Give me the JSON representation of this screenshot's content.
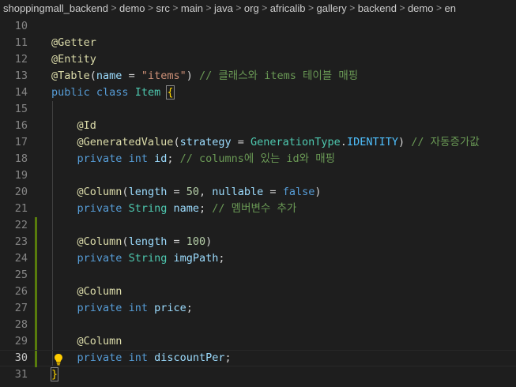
{
  "breadcrumb": {
    "items": [
      "shoppingmall_backend",
      "demo",
      "src",
      "main",
      "java",
      "org",
      "africalib",
      "gallery",
      "backend",
      "demo",
      "en"
    ],
    "separator": ">"
  },
  "editor": {
    "active_line": "30",
    "lines": [
      {
        "num": "10",
        "tokens": []
      },
      {
        "num": "11",
        "tokens": [
          {
            "t": "@Getter",
            "c": "annot"
          }
        ]
      },
      {
        "num": "12",
        "tokens": [
          {
            "t": "@Entity",
            "c": "annot"
          }
        ]
      },
      {
        "num": "13",
        "tokens": [
          {
            "t": "@Table",
            "c": "annot"
          },
          {
            "t": "(",
            "c": "plain"
          },
          {
            "t": "name",
            "c": "var"
          },
          {
            "t": " = ",
            "c": "plain"
          },
          {
            "t": "\"items\"",
            "c": "str"
          },
          {
            "t": ") ",
            "c": "plain"
          },
          {
            "t": "// 클래스와 items 테이블 매핑",
            "c": "comment"
          }
        ]
      },
      {
        "num": "14",
        "tokens": [
          {
            "t": "public",
            "c": "kw"
          },
          {
            "t": " ",
            "c": "plain"
          },
          {
            "t": "class",
            "c": "kw"
          },
          {
            "t": " ",
            "c": "plain"
          },
          {
            "t": "Item",
            "c": "type"
          },
          {
            "t": " ",
            "c": "plain"
          },
          {
            "t": "{",
            "c": "brace"
          }
        ]
      },
      {
        "num": "15",
        "tokens": []
      },
      {
        "num": "16",
        "tokens": [
          {
            "t": "    ",
            "c": "plain"
          },
          {
            "t": "@Id",
            "c": "annot"
          }
        ]
      },
      {
        "num": "17",
        "tokens": [
          {
            "t": "    ",
            "c": "plain"
          },
          {
            "t": "@GeneratedValue",
            "c": "annot"
          },
          {
            "t": "(",
            "c": "plain"
          },
          {
            "t": "strategy",
            "c": "var"
          },
          {
            "t": " = ",
            "c": "plain"
          },
          {
            "t": "GenerationType",
            "c": "type"
          },
          {
            "t": ".",
            "c": "plain"
          },
          {
            "t": "IDENTITY",
            "c": "const"
          },
          {
            "t": ") ",
            "c": "plain"
          },
          {
            "t": "// 자동증가값",
            "c": "comment"
          }
        ]
      },
      {
        "num": "18",
        "tokens": [
          {
            "t": "    ",
            "c": "plain"
          },
          {
            "t": "private",
            "c": "kw"
          },
          {
            "t": " ",
            "c": "plain"
          },
          {
            "t": "int",
            "c": "kw"
          },
          {
            "t": " ",
            "c": "plain"
          },
          {
            "t": "id",
            "c": "var"
          },
          {
            "t": "; ",
            "c": "plain"
          },
          {
            "t": "// columns에 있는 id와 매핑",
            "c": "comment"
          }
        ]
      },
      {
        "num": "19",
        "tokens": []
      },
      {
        "num": "20",
        "tokens": [
          {
            "t": "    ",
            "c": "plain"
          },
          {
            "t": "@Column",
            "c": "annot"
          },
          {
            "t": "(",
            "c": "plain"
          },
          {
            "t": "length",
            "c": "var"
          },
          {
            "t": " = ",
            "c": "plain"
          },
          {
            "t": "50",
            "c": "num"
          },
          {
            "t": ", ",
            "c": "plain"
          },
          {
            "t": "nullable",
            "c": "var"
          },
          {
            "t": " = ",
            "c": "plain"
          },
          {
            "t": "false",
            "c": "kw"
          },
          {
            "t": ")",
            "c": "plain"
          }
        ]
      },
      {
        "num": "21",
        "tokens": [
          {
            "t": "    ",
            "c": "plain"
          },
          {
            "t": "private",
            "c": "kw"
          },
          {
            "t": " ",
            "c": "plain"
          },
          {
            "t": "String",
            "c": "type"
          },
          {
            "t": " ",
            "c": "plain"
          },
          {
            "t": "name",
            "c": "var"
          },
          {
            "t": "; ",
            "c": "plain"
          },
          {
            "t": "// 멤버변수 추가",
            "c": "comment"
          }
        ]
      },
      {
        "num": "22",
        "tokens": []
      },
      {
        "num": "23",
        "tokens": [
          {
            "t": "    ",
            "c": "plain"
          },
          {
            "t": "@Column",
            "c": "annot"
          },
          {
            "t": "(",
            "c": "plain"
          },
          {
            "t": "length",
            "c": "var"
          },
          {
            "t": " = ",
            "c": "plain"
          },
          {
            "t": "100",
            "c": "num"
          },
          {
            "t": ")",
            "c": "plain"
          }
        ]
      },
      {
        "num": "24",
        "tokens": [
          {
            "t": "    ",
            "c": "plain"
          },
          {
            "t": "private",
            "c": "kw"
          },
          {
            "t": " ",
            "c": "plain"
          },
          {
            "t": "String",
            "c": "type"
          },
          {
            "t": " ",
            "c": "plain"
          },
          {
            "t": "imgPath",
            "c": "var"
          },
          {
            "t": ";",
            "c": "plain"
          }
        ]
      },
      {
        "num": "25",
        "tokens": []
      },
      {
        "num": "26",
        "tokens": [
          {
            "t": "    ",
            "c": "plain"
          },
          {
            "t": "@Column",
            "c": "annot"
          }
        ]
      },
      {
        "num": "27",
        "tokens": [
          {
            "t": "    ",
            "c": "plain"
          },
          {
            "t": "private",
            "c": "kw"
          },
          {
            "t": " ",
            "c": "plain"
          },
          {
            "t": "int",
            "c": "kw"
          },
          {
            "t": " ",
            "c": "plain"
          },
          {
            "t": "price",
            "c": "var"
          },
          {
            "t": ";",
            "c": "plain"
          }
        ]
      },
      {
        "num": "28",
        "tokens": []
      },
      {
        "num": "29",
        "tokens": [
          {
            "t": "    ",
            "c": "plain"
          },
          {
            "t": "@Column",
            "c": "annot"
          }
        ]
      },
      {
        "num": "30",
        "tokens": [
          {
            "t": "    ",
            "c": "plain"
          },
          {
            "t": "private",
            "c": "kw"
          },
          {
            "t": " ",
            "c": "plain"
          },
          {
            "t": "int",
            "c": "kw"
          },
          {
            "t": " ",
            "c": "plain"
          },
          {
            "t": "discountPer",
            "c": "var"
          },
          {
            "t": ";",
            "c": "plain"
          }
        ]
      },
      {
        "num": "31",
        "tokens": [
          {
            "t": "}",
            "c": "brace"
          }
        ]
      }
    ],
    "modified_lines": [
      "22",
      "23",
      "24",
      "25",
      "26",
      "27",
      "28",
      "29",
      "30"
    ],
    "lightbulb_line": "30",
    "colors": {
      "background": "#1e1e1e",
      "annotation": "#dcdcaa",
      "keyword": "#569cd6",
      "type": "#4ec9b0",
      "string": "#ce9178",
      "number": "#b5cea8",
      "comment": "#6a9955",
      "variable": "#9cdcfe",
      "constant": "#4fc1ff",
      "brace": "#ffd700",
      "gutter_modified": "#587c0c"
    },
    "icons": {
      "lightbulb": "lightbulb-icon",
      "separator": "chevron-right-icon"
    }
  }
}
